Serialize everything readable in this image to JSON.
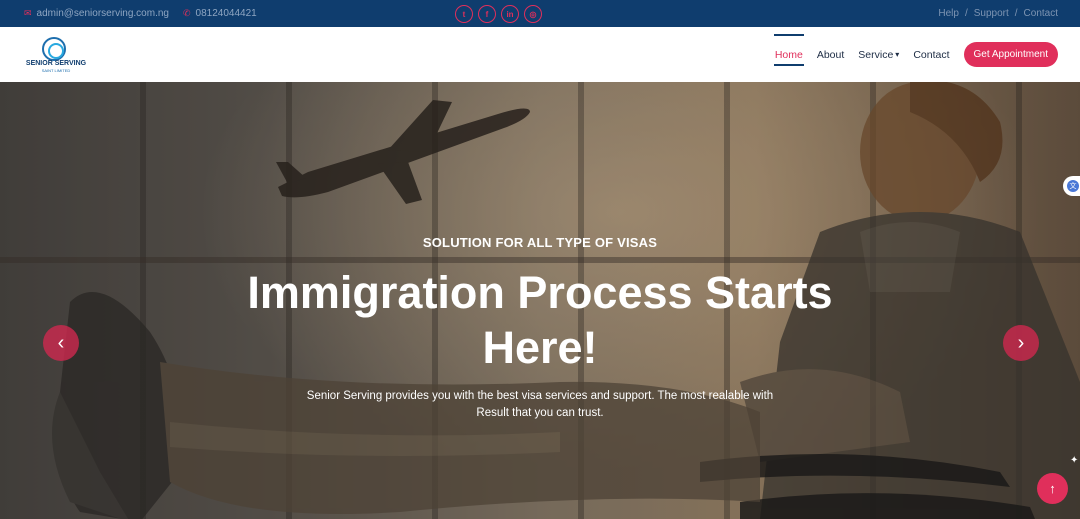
{
  "topbar": {
    "email": "admin@seniorserving.com.ng",
    "phone": "08124044421",
    "social": [
      {
        "icon": "twitter-icon",
        "glyph": "t"
      },
      {
        "icon": "facebook-icon",
        "glyph": "f"
      },
      {
        "icon": "linkedin-icon",
        "glyph": "in"
      },
      {
        "icon": "instagram-icon",
        "glyph": "◎"
      }
    ],
    "links": [
      "Help",
      "/",
      "Support",
      "/",
      "Contact"
    ]
  },
  "brand": {
    "name": "SENIOR SERVING",
    "sub": "SAINT LIMITED"
  },
  "nav": {
    "items": [
      "Home",
      "About",
      "Service",
      "Contact"
    ],
    "active": "Home",
    "cta": "Get Appointment"
  },
  "hero": {
    "kicker": "SOLUTION FOR ALL TYPE OF VISAS",
    "headline": "Immigration Process Starts Here!",
    "description": "Senior Serving provides you with the best visa services and support. The most realable with Result that you can trust."
  },
  "colors": {
    "topbar": "#0f3d6e",
    "accent": "#e02f5b",
    "nav_text": "#1d2c44"
  }
}
